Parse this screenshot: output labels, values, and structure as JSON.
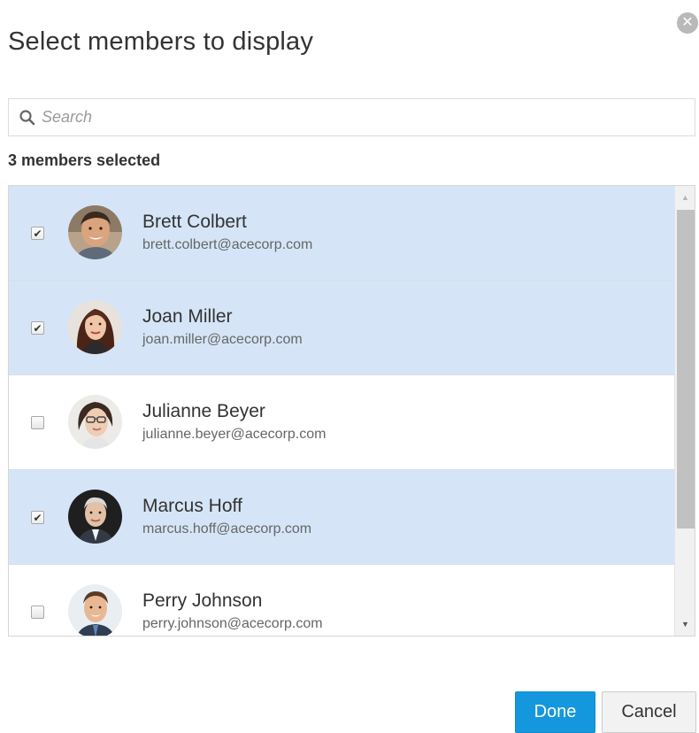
{
  "dialog": {
    "title": "Select members to display",
    "close_icon": "close-circle-icon"
  },
  "search": {
    "placeholder": "Search",
    "value": "",
    "icon": "search-icon"
  },
  "selection": {
    "count_label": "3 members selected"
  },
  "members": [
    {
      "name": "Brett Colbert",
      "email": "brett.colbert@acecorp.com",
      "selected": true
    },
    {
      "name": "Joan Miller",
      "email": "joan.miller@acecorp.com",
      "selected": true
    },
    {
      "name": "Julianne Beyer",
      "email": "julianne.beyer@acecorp.com",
      "selected": false
    },
    {
      "name": "Marcus Hoff",
      "email": "marcus.hoff@acecorp.com",
      "selected": true
    },
    {
      "name": "Perry Johnson",
      "email": "perry.johnson@acecorp.com",
      "selected": false
    }
  ],
  "buttons": {
    "done_label": "Done",
    "cancel_label": "Cancel"
  },
  "colors": {
    "selected_row": "#d5e5f7",
    "primary_button": "#1497dd"
  }
}
